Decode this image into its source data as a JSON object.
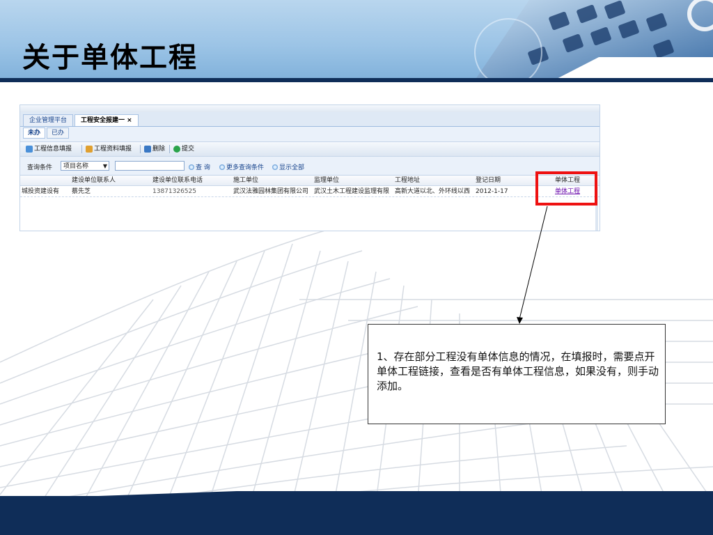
{
  "slide": {
    "title": "关于单体工程",
    "callout_text": "1、存在部分工程没有单体信息的情况，在填报时，需要点开单体工程链接，查看是否有单体工程信息，如果没有，则手动添加。"
  },
  "app": {
    "tabs": [
      {
        "label": "企业管理平台"
      },
      {
        "label": "工程安全报建一 ×"
      }
    ],
    "subtabs": [
      {
        "label": "未办"
      },
      {
        "label": "已办"
      }
    ],
    "toolbar": {
      "fill_info": "工程信息填报",
      "fill_docs": "工程资料填报",
      "delete": "删除",
      "submit": "提交"
    },
    "query": {
      "label": "查询条件",
      "field_selected": "项目名称",
      "search": "查 询",
      "more": "更多查询条件",
      "show_all": "显示全部"
    },
    "grid": {
      "headers": [
        "",
        "建设单位联系人",
        "建设单位联系电话",
        "施工单位",
        "监理单位",
        "工程地址",
        "登记日期",
        "单体工程"
      ],
      "rows": [
        [
          "城投资建设有",
          "蔡先芝",
          "13871326525",
          "武汉法雅园林集团有限公司",
          "武汉土木工程建设监理有限",
          "高新大道以北、外环线以西",
          "2012-1-17",
          "单体工程"
        ]
      ]
    }
  },
  "colors": {
    "header_band": "#9cc4e6",
    "dark_navy": "#0f2d58",
    "highlight_red": "#ee1111",
    "link_purple": "#6a0dad"
  }
}
